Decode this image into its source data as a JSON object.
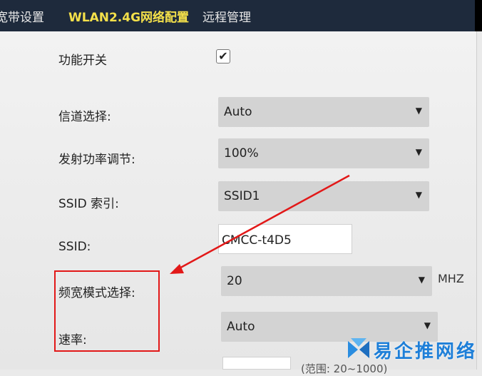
{
  "nav": {
    "tabs": [
      {
        "label": "宽带设置"
      },
      {
        "label": "WLAN2.4G网络配置"
      },
      {
        "label": "远程管理"
      }
    ]
  },
  "form": {
    "enable_label": "功能开关",
    "enable_checked": true,
    "channel_label": "信道选择:",
    "channel_value": "Auto",
    "tx_power_label": "发射功率调节:",
    "tx_power_value": "100%",
    "ssid_index_label": "SSID 索引:",
    "ssid_index_value": "SSID1",
    "ssid_label": "SSID:",
    "ssid_value": "CMCC-t4D5",
    "bandwidth_label": "频宽模式选择:",
    "bandwidth_value": "20",
    "bandwidth_unit": "MHZ",
    "rate_label": "速率:",
    "rate_value": "Auto",
    "range_hint": "(范围: 20~1000)"
  },
  "watermark": {
    "text": "易企推网络"
  },
  "colors": {
    "nav_bg": "#1e2a3c",
    "active_tab": "#f4e04a",
    "annotation_red": "#e21818",
    "watermark_blue": "#1e7fd8"
  },
  "icons": {
    "check": "checkmark-icon",
    "caret": "caret-down-icon"
  }
}
